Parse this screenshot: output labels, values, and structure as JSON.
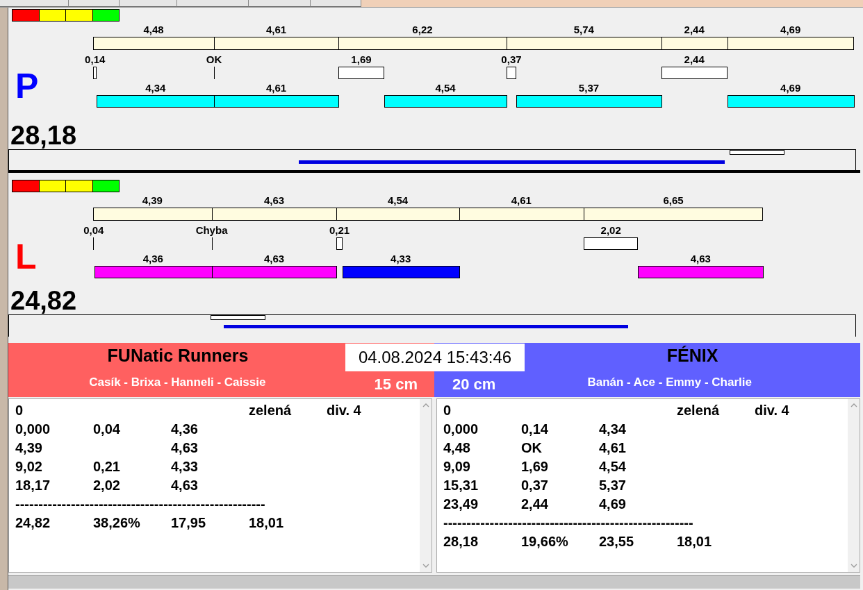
{
  "lanes": [
    {
      "letter": "P",
      "color": "#0000ff",
      "total": "28,18",
      "segments": [
        {
          "split": "4,48",
          "gap": "0,14",
          "run": {
            "value": "4,34",
            "color": "#00ffff"
          }
        },
        {
          "split": "4,61",
          "gap": "OK",
          "run": {
            "value": "4,61",
            "color": "#00ffff"
          }
        },
        {
          "split": "6,22",
          "gap": "1,69",
          "run": {
            "value": "4,54",
            "color": "#00ffff"
          }
        },
        {
          "split": "5,74",
          "gap": "0,37",
          "run": {
            "value": "5,37",
            "color": "#00ffff"
          }
        },
        {
          "split": "2,44",
          "gap": "2,44"
        },
        {
          "split": "4,69",
          "run": {
            "value": "4,69",
            "color": "#00ffff"
          }
        }
      ]
    },
    {
      "letter": "L",
      "color": "#ff0000",
      "total": "24,82",
      "segments": [
        {
          "split": "4,39",
          "gap": "0,04",
          "run": {
            "value": "4,36",
            "color": "#ff00ff"
          }
        },
        {
          "split": "4,63",
          "gap": "Chyba",
          "run": {
            "value": "4,63",
            "color": "#ff00ff"
          }
        },
        {
          "split": "4,54",
          "gap": "0,21",
          "run": {
            "value": "4,33",
            "color": "#0000ff"
          }
        },
        {
          "split": "4,61"
        },
        {
          "split": "6,65",
          "gap": "2,02",
          "run": {
            "value": "4,63",
            "color": "#ff00ff"
          }
        }
      ]
    }
  ],
  "datetime": "04.08.2024 15:43:46",
  "teams": [
    {
      "name": "FUNatic Runners",
      "members": "Casík - Brixa - Hanneli - Caissie",
      "height": "15 cm",
      "color": "#ff6060",
      "log": {
        "header": {
          "code": "0",
          "color_name": "zelená",
          "division": "div. 4"
        },
        "rows": [
          {
            "time": "0,000",
            "gap": "0,04",
            "run": "4,36"
          },
          {
            "time": "4,39",
            "run": "4,63"
          },
          {
            "time": "9,02",
            "gap": "0,21",
            "run": "4,33"
          },
          {
            "time": "18,17",
            "gap": "2,02",
            "run": "4,63"
          }
        ],
        "separator": "------------------------------------------------------",
        "summary": {
          "total": "24,82",
          "percent": "38,26%",
          "column_3": "17,95",
          "column_4": "18,01"
        }
      }
    },
    {
      "name": "FÉNIX",
      "members": "Banán - Ace - Emmy - Charlie",
      "height": "20 cm",
      "color": "#6060ff",
      "log": {
        "header": {
          "code": "0",
          "color_name": "zelená",
          "division": "div. 4"
        },
        "rows": [
          {
            "time": "0,000",
            "gap": "0,14",
            "run": "4,34"
          },
          {
            "time": "4,48",
            "gap": "OK",
            "run": "4,61"
          },
          {
            "time": "9,09",
            "gap": "1,69",
            "run": "4,54"
          },
          {
            "time": "15,31",
            "gap": "0,37",
            "run": "5,37"
          },
          {
            "time": "23,49",
            "gap": "2,44",
            "run": "4,69"
          }
        ],
        "separator": "------------------------------------------------------",
        "summary": {
          "total": "28,18",
          "percent": "19,66%",
          "column_3": "23,55",
          "column_4": "18,01"
        }
      }
    }
  ]
}
